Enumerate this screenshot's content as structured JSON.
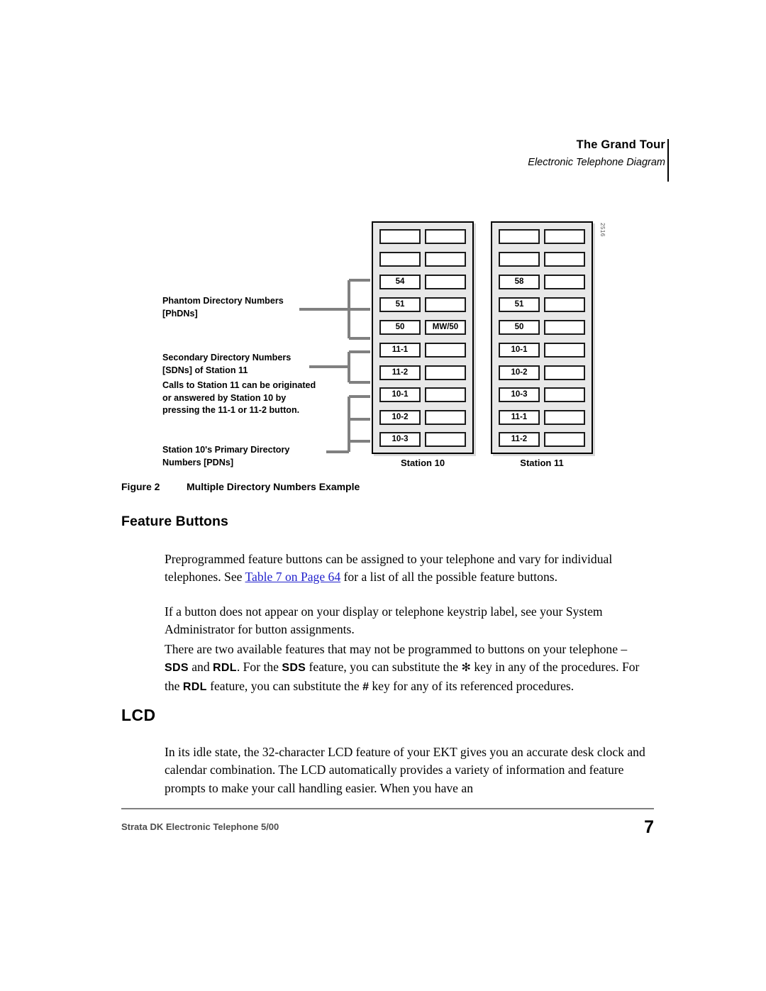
{
  "header": {
    "title": "The Grand Tour",
    "subtitle": "Electronic Telephone Diagram"
  },
  "figure": {
    "id_mark": "2516",
    "caption_number": "Figure 2",
    "caption_text": "Multiple Directory Numbers Example",
    "callouts": {
      "phdn": "Phantom Directory Numbers\n[PhDNs]",
      "sdn": "Secondary Directory Numbers\n[SDNs] of Station 11",
      "note": "Calls to Station 11 can be originated\nor answered by Station 10 by\npressing the 11-1 or 11-2 button.",
      "pdn": "Station 10's Primary Directory\nNumbers [PDNs]"
    },
    "stations": [
      {
        "label": "Station 10",
        "left_keys": [
          "",
          "",
          "54",
          "51",
          "50",
          "11-1",
          "11-2",
          "10-1",
          "10-2",
          "10-3"
        ],
        "right_keys": [
          "",
          "",
          "",
          "",
          "MW/50",
          "",
          "",
          "",
          "",
          ""
        ]
      },
      {
        "label": "Station 11",
        "left_keys": [
          "",
          "",
          "58",
          "51",
          "50",
          "10-1",
          "10-2",
          "10-3",
          "11-1",
          "11-2"
        ],
        "right_keys": [
          "",
          "",
          "",
          "",
          "",
          "",
          "",
          "",
          "",
          ""
        ]
      }
    ]
  },
  "sections": {
    "feature_buttons_heading": "Feature Buttons",
    "lcd_heading": "LCD"
  },
  "paragraphs": {
    "p1_a": "Preprogrammed feature buttons can be assigned to your telephone and vary for individual telephones. See ",
    "p1_link": "Table 7 on Page 64",
    "p1_b": " for a list of all the possible feature buttons.",
    "p2": "If a button does not appear on your display or telephone keystrip label, see your System Administrator for button assignments.",
    "p3_a": "There are two available features that may not be programmed to buttons on your telephone – ",
    "p3_sds1": "SDS",
    "p3_b": " and ",
    "p3_rdl1": "RDL",
    "p3_c": ". For the ",
    "p3_sds2": "SDS",
    "p3_d": " feature, you can substitute the ",
    "p3_star": "✻",
    "p3_e": " key in any of the procedures. For the ",
    "p3_rdl2": "RDL",
    "p3_f": " feature, you can substitute the ",
    "p3_hash": "#",
    "p3_g": " key for any of its referenced procedures.",
    "p4": "In its idle state, the 32-character LCD feature of your EKT gives you an accurate desk clock and calendar combination. The LCD automatically provides a variety of information and feature prompts to make your call handling easier. When you have an"
  },
  "footer": {
    "text": "Strata DK Electronic Telephone   5/00",
    "page_number": "7"
  },
  "colors": {
    "link": "#2222cc",
    "phone_body": "#e8e8e8",
    "leader": "#808080",
    "footer_text": "#4d4d4d"
  }
}
